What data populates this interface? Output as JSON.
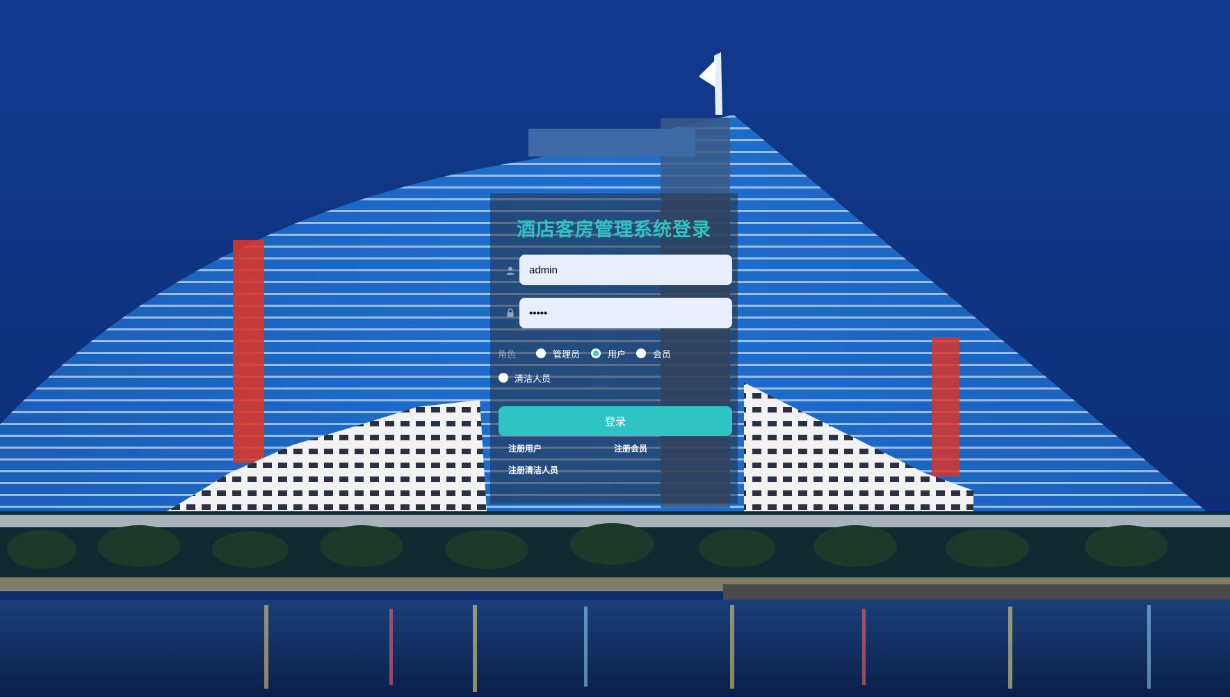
{
  "background": {
    "sky_color": "#0e3c8f",
    "accent": "#2ec4c4"
  },
  "login": {
    "title": "酒店客房管理系统登录",
    "username_value": "admin",
    "password_value": "•••••",
    "role_label": "角色",
    "roles": [
      {
        "label": "管理员",
        "checked": false
      },
      {
        "label": "用户",
        "checked": true
      },
      {
        "label": "会员",
        "checked": false
      },
      {
        "label": "清洁人员",
        "checked": false
      }
    ],
    "login_button": "登录",
    "links": {
      "register_user": "注册用户",
      "register_member": "注册会员",
      "register_cleaner": "注册清洁人员"
    },
    "icons": {
      "username": "user-icon",
      "password": "lock-icon"
    }
  }
}
